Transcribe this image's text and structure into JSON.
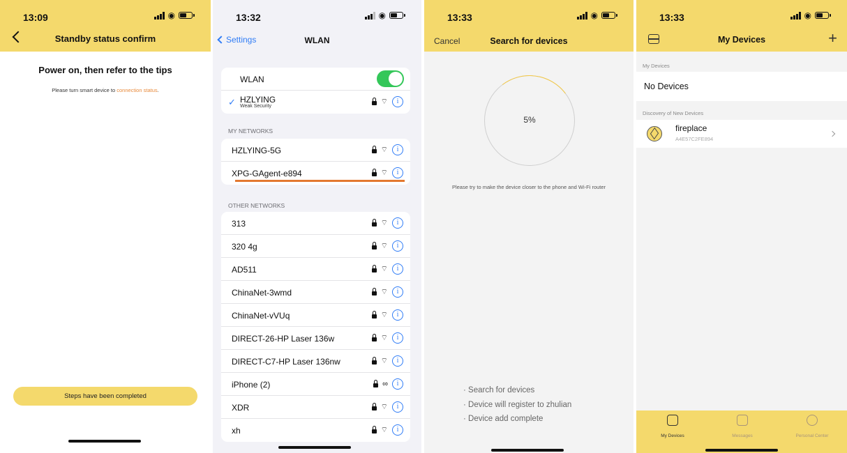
{
  "screen1": {
    "time": "13:09",
    "title": "Standby status confirm",
    "heading": "Power on, then refer to the tips",
    "tip_prefix": "Please turn smart device to",
    "tip_link": "connection status",
    "tip_suffix": ".",
    "button_label": "Steps have been completed"
  },
  "screen2": {
    "time": "13:32",
    "back_label": "Settings",
    "title": "WLAN",
    "wlan_label": "WLAN",
    "wlan_enabled": true,
    "connected": {
      "name": "HZLYING",
      "security_note": "Weak Security"
    },
    "my_networks_header": "MY NETWORKS",
    "my_networks": [
      {
        "name": "HZLYING-5G"
      },
      {
        "name": "XPG-GAgent-e894"
      }
    ],
    "other_networks_header": "OTHER NETWORKS",
    "other_networks": [
      {
        "name": "313"
      },
      {
        "name": "320 4g"
      },
      {
        "name": "AD511"
      },
      {
        "name": "ChinaNet-3wmd"
      },
      {
        "name": "ChinaNet-vVUq"
      },
      {
        "name": "DIRECT-26-HP Laser 136w"
      },
      {
        "name": "DIRECT-C7-HP Laser 136nw"
      },
      {
        "name": "iPhone (2)"
      },
      {
        "name": "XDR"
      },
      {
        "name": "xh"
      }
    ]
  },
  "screen3": {
    "time": "13:33",
    "cancel_label": "Cancel",
    "title": "Search for devices",
    "progress_text": "5%",
    "progress_fraction": 0.05,
    "tip": "Please try to make the device closer to the phone and Wi-Fi router",
    "steps": [
      "· Search for devices",
      "· Device will register to zhulian",
      "· Device add complete"
    ]
  },
  "screen4": {
    "time": "13:33",
    "title": "My Devices",
    "my_devices_header": "My Devices",
    "no_devices": "No Devices",
    "discovery_header": "Discovery of New Devices",
    "device": {
      "name": "fireplace",
      "id": "A4E57C2FE894"
    },
    "tabs": [
      "My Devices",
      "Messages",
      "Personal Center"
    ]
  },
  "colors": {
    "accent_yellow": "#f4d96c",
    "link_orange": "#e8893a",
    "ios_blue": "#2f7cf6",
    "toggle_green": "#34c759",
    "highlight_line": "#e3782f"
  }
}
